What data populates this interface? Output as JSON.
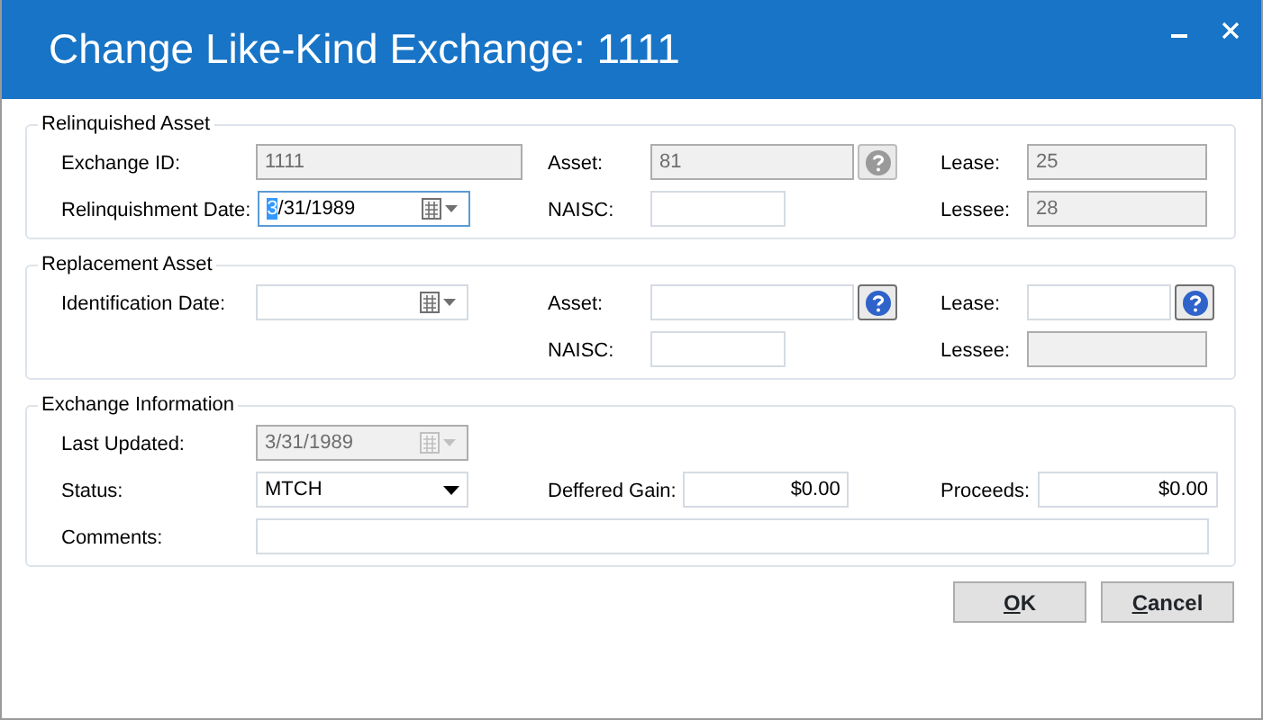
{
  "window": {
    "title": "Change Like-Kind Exchange: 1111"
  },
  "sections": [
    {
      "title": "Relinquished Asset",
      "rows": [
        [
          {
            "label": "Exchange ID:",
            "kind": "text",
            "value": "1111",
            "disabled": true
          },
          {
            "label": "Asset:",
            "kind": "lookup",
            "value": "81",
            "disabled": true
          },
          {
            "label": "Lease:",
            "kind": "text",
            "value": "25",
            "disabled": true
          }
        ],
        [
          {
            "label": "Relinquishment Date:",
            "kind": "date",
            "value": "3/31/1989",
            "disabled": false,
            "focused": true
          },
          {
            "label": "NAISC:",
            "kind": "text",
            "disabled": false
          },
          {
            "label": "Lessee:",
            "kind": "text",
            "value": "28",
            "disabled": true
          }
        ]
      ]
    },
    {
      "title": "Replacement Asset",
      "rows": [
        [
          {
            "label": "Identification Date:",
            "kind": "date",
            "disabled": false
          },
          {
            "label": "Asset:",
            "kind": "lookup",
            "disabled": false
          },
          {
            "label": "Lease:",
            "kind": "lookup",
            "disabled": false
          }
        ],
        [
          "",
          {
            "label": "NAISC:",
            "kind": "text",
            "disabled": false
          },
          {
            "label": "Lessee:",
            "kind": "text",
            "disabled": true
          }
        ]
      ]
    },
    {
      "title": "Exchange Information",
      "rows": [
        [
          {
            "label": "Last Updated:",
            "kind": "date",
            "value": "3/31/1989",
            "disabled": true
          }
        ],
        [
          {
            "label": "Status:",
            "kind": "combo",
            "value": "MTCH",
            "disabled": false
          },
          {
            "label": "Deffered Gain:",
            "kind": "money",
            "value": "$0.00",
            "disabled": false
          },
          {
            "label": "Proceeds:",
            "kind": "money",
            "value": "$0.00",
            "disabled": false
          }
        ],
        [
          {
            "label": "Comments:",
            "kind": "wide",
            "disabled": false
          }
        ]
      ]
    }
  ],
  "buttons": [
    {
      "label": "OK"
    },
    {
      "label": "Cancel"
    }
  ]
}
